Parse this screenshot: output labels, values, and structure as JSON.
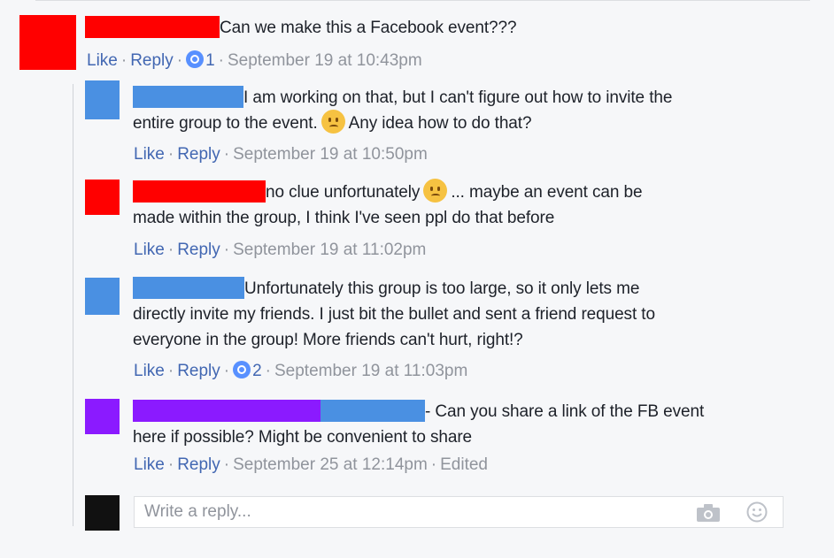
{
  "comments": [
    {
      "text": "Can we make this a Facebook event???",
      "like_label": "Like",
      "reply_label": "Reply",
      "reaction_count": "1",
      "timestamp": "September 19 at 10:43pm",
      "avatar_color": "#ff0000",
      "name_colors": [
        "#ff0000"
      ]
    },
    {
      "text_line1": "I am working on that, but I can't figure out how to invite the",
      "text_line2_a": "entire group to the event.",
      "emoji": "sad-face",
      "text_line2_b": "Any idea how to do that?",
      "like_label": "Like",
      "reply_label": "Reply",
      "timestamp": "September 19 at 10:50pm",
      "avatar_color": "#4a90e2",
      "name_colors": [
        "#4a90e2"
      ]
    },
    {
      "text_line1_a": "no clue unfortunately",
      "emoji": "sad-face",
      "text_line1_b": "... maybe an event can be",
      "text_line2": "made within the group, I think I've seen ppl do that before",
      "like_label": "Like",
      "reply_label": "Reply",
      "timestamp": "September 19 at 11:02pm",
      "avatar_color": "#ff0000",
      "name_colors": [
        "#ff0000"
      ]
    },
    {
      "text_line1": "Unfortunately this group is too large, so it only lets me",
      "text_line2": "directly invite my friends. I just bit the bullet and sent a friend request to",
      "text_line3": "everyone in the group! More friends can't hurt, right!?",
      "like_label": "Like",
      "reply_label": "Reply",
      "reaction_count": "2",
      "timestamp": "September 19 at 11:03pm",
      "avatar_color": "#4a90e2",
      "name_colors": [
        "#4a90e2"
      ]
    },
    {
      "text_line1": "- Can you share a link of the FB event",
      "text_line2": "here if possible? Might be convenient to share",
      "like_label": "Like",
      "reply_label": "Reply",
      "timestamp": "September 25 at 12:14pm",
      "edited_label": "Edited",
      "avatar_color": "#8b1aff",
      "name_colors": [
        "#8b1aff",
        "#4a90e2"
      ]
    }
  ],
  "reply_box": {
    "placeholder": "Write a reply...",
    "avatar_color": "#111111",
    "camera_icon": "camera-icon",
    "emoji_icon": "smiley-icon"
  }
}
